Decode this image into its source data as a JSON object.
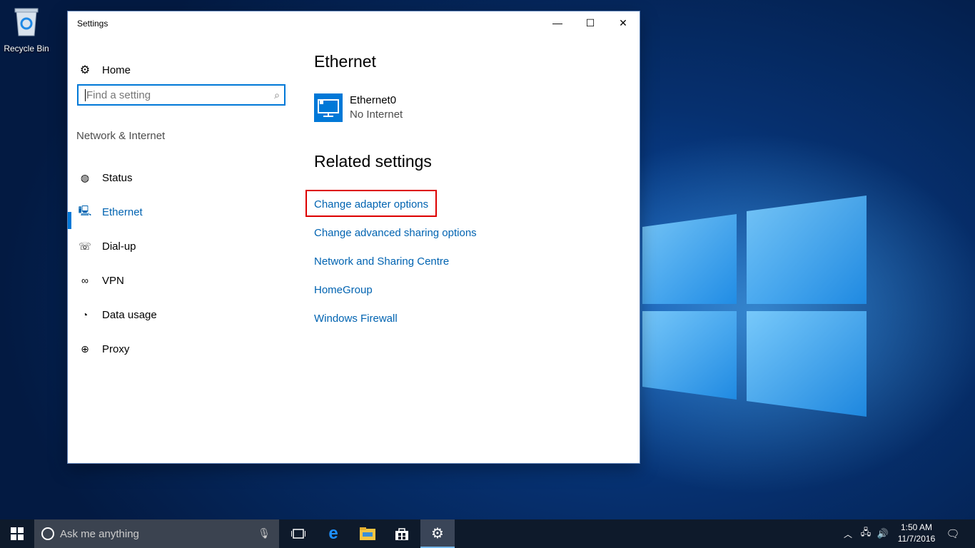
{
  "desktop": {
    "recycle_bin_label": "Recycle Bin"
  },
  "window": {
    "title": "Settings",
    "controls": {
      "minimize": "—",
      "maximize": "☐",
      "close": "✕"
    }
  },
  "nav": {
    "home_label": "Home",
    "search_placeholder": "Find a setting",
    "section_label": "Network & Internet",
    "items": [
      {
        "label": "Status",
        "icon": "status-globe-icon"
      },
      {
        "label": "Ethernet",
        "icon": "ethernet-icon",
        "active": true
      },
      {
        "label": "Dial-up",
        "icon": "dialup-icon"
      },
      {
        "label": "VPN",
        "icon": "vpn-icon"
      },
      {
        "label": "Data usage",
        "icon": "data-usage-icon"
      },
      {
        "label": "Proxy",
        "icon": "proxy-globe-icon"
      }
    ]
  },
  "content": {
    "heading": "Ethernet",
    "adapter": {
      "name": "Ethernet0",
      "status": "No Internet"
    },
    "related_heading": "Related settings",
    "links": [
      "Change adapter options",
      "Change advanced sharing options",
      "Network and Sharing Centre",
      "HomeGroup",
      "Windows Firewall"
    ]
  },
  "taskbar": {
    "search_placeholder": "Ask me anything",
    "time": "1:50 AM",
    "date": "11/7/2016"
  },
  "colors": {
    "accent": "#0078d7",
    "link": "#0063b1",
    "highlight_box": "#dd0000",
    "taskbar": "#0e1a2b"
  }
}
